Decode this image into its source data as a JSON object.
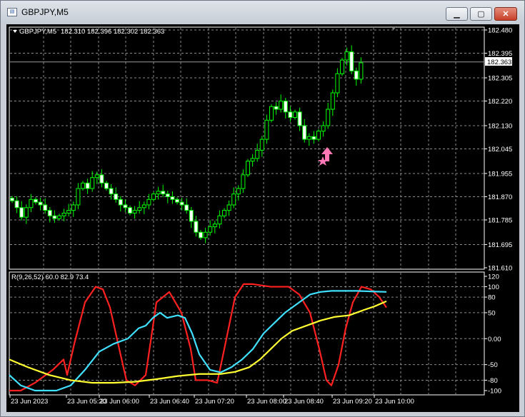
{
  "window": {
    "title": "GBPJPY,M5",
    "icon": "chart-window-icon",
    "buttons": [
      "minimize-icon",
      "maximize-icon",
      "close-icon"
    ]
  },
  "price_chart": {
    "header_symbol": "GBPJPY,M5",
    "header_ohlc": "182.310 182.396 182.302 182.363",
    "current_price_label": "182.363",
    "current_price": 182.363,
    "price_axis_ticks": [
      "182.480",
      "182.395",
      "182.305",
      "182.220",
      "182.130",
      "182.045",
      "181.955",
      "181.870",
      "181.785",
      "181.695",
      "181.610"
    ],
    "price_axis_values": [
      182.48,
      182.395,
      182.305,
      182.22,
      182.13,
      182.045,
      181.955,
      181.87,
      181.785,
      181.695,
      181.61
    ],
    "up_color": "#00ff00",
    "down_color": "#ffffff",
    "arrow_color": "#ff77b4"
  },
  "indicator": {
    "header": "R(9,26,52) 60.0 82.9 73.4",
    "axis_ticks": [
      "120",
      "100",
      "80",
      "50",
      "0.00",
      "-50",
      "-80",
      "-100"
    ],
    "axis_values": [
      120,
      100,
      80,
      50,
      0,
      -50,
      -80,
      -100
    ],
    "colors": {
      "red": "#ff2020",
      "cyan": "#40e0ff",
      "yellow": "#ffff33"
    }
  },
  "time_axis": {
    "labels": [
      "23 Jun 2023",
      "23 Jun 05:20",
      "23 Jun 06:00",
      "23 Jun 06:40",
      "23 Jun 07:20",
      "23 Jun 08:00",
      "23 Jun 08:40",
      "23 Jun 09:20",
      "23 Jun 10:00"
    ]
  }
}
